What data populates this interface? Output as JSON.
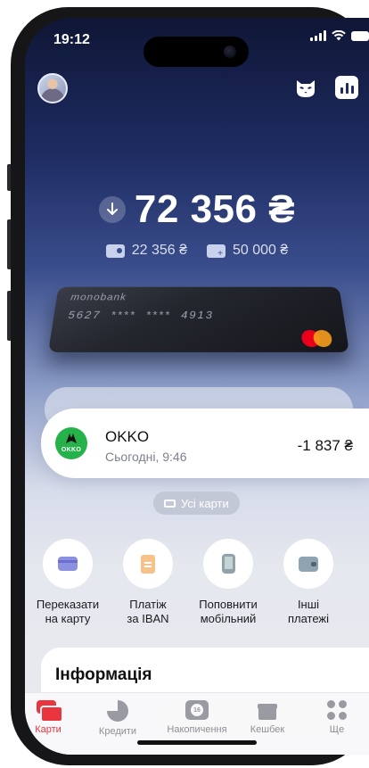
{
  "status_bar": {
    "time": "19:12"
  },
  "header": {
    "avatar_icon": "avatar",
    "cat_icon": "cat-icon",
    "stats_icon": "bar-chart-icon"
  },
  "balance": {
    "amount": "72 356 ₴",
    "icon": "arrow-down-icon"
  },
  "sub_balances": [
    {
      "icon": "card-icon",
      "value": "22 356 ₴"
    },
    {
      "icon": "card-plus-icon",
      "value": "50 000 ₴"
    }
  ],
  "card": {
    "brand": "monobank",
    "number": "5627  ****  ****  4913",
    "network_icon": "mastercard-logo"
  },
  "transaction": {
    "merchant": "OKKO",
    "logo_text": "OKKO",
    "time": "Сьогодні, 9:46",
    "amount": "-1 837 ₴"
  },
  "all_cards": {
    "label": "Усі карти"
  },
  "actions": [
    {
      "label": "Переказати\nна карту",
      "icon": "card-icon"
    },
    {
      "label": "Платіж\nза IBAN",
      "icon": "document-icon"
    },
    {
      "label": "Поповнити\nмобільний",
      "icon": "phone-icon"
    },
    {
      "label": "Інші\nплатежі",
      "icon": "wallet-icon"
    }
  ],
  "info": {
    "title": "Інформація"
  },
  "tabs": [
    {
      "label": "Карти",
      "icon": "cards-icon",
      "active": true
    },
    {
      "label": "Кредити",
      "icon": "pie-chart-icon"
    },
    {
      "label": "Накопичення",
      "icon": "savings-icon",
      "icon_text": "16"
    },
    {
      "label": "Кешбек",
      "icon": "gift-icon"
    },
    {
      "label": "Ще",
      "icon": "more-icon"
    }
  ],
  "colors": {
    "accent": "#e8353e",
    "bg_top": "#0f1635",
    "bg_bottom": "#eaeaee",
    "okko_green": "#25b24a"
  }
}
